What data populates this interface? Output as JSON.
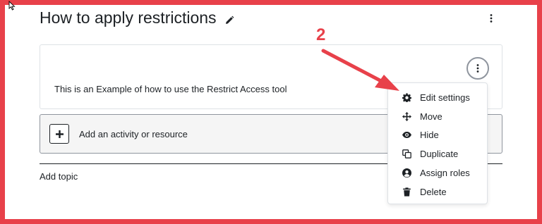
{
  "page": {
    "title": "How to apply restrictions"
  },
  "section": {
    "description": "This is an Example of how to use the Restrict Access tool"
  },
  "add_activity": {
    "label": "Add an activity or resource"
  },
  "add_topic": {
    "label": "Add topic"
  },
  "action_menu": {
    "items": [
      {
        "label": "Edit settings",
        "icon": "gear-icon"
      },
      {
        "label": "Move",
        "icon": "move-arrows-icon"
      },
      {
        "label": "Hide",
        "icon": "eye-icon"
      },
      {
        "label": "Duplicate",
        "icon": "copy-icon"
      },
      {
        "label": "Assign roles",
        "icon": "user-circle-icon"
      },
      {
        "label": "Delete",
        "icon": "trash-icon"
      }
    ]
  },
  "annotation": {
    "step_number": "2",
    "color": "#e8414a"
  }
}
